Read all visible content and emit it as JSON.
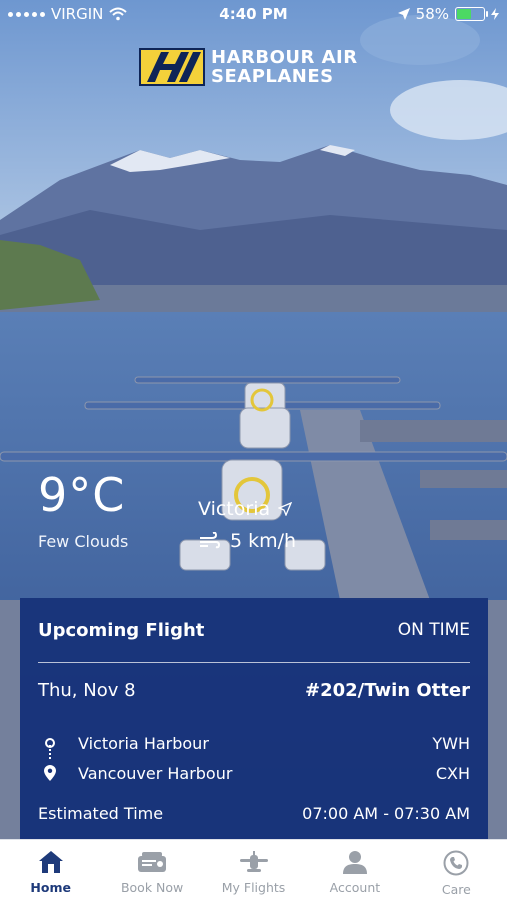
{
  "status_bar": {
    "carrier": "VIRGIN",
    "time": "4:40 PM",
    "battery": "58%"
  },
  "brand": {
    "line1": "HARBOUR AIR",
    "line2": "SEAPLANES",
    "accent": "#f4d13a",
    "navy": "#0e2557"
  },
  "weather": {
    "temperature": "9°C",
    "condition": "Few Clouds",
    "location": "Victoria",
    "wind": "5 km/h"
  },
  "upcoming_flight": {
    "title": "Upcoming Flight",
    "status": "ON TIME",
    "date": "Thu, Nov 8",
    "flight": "#202/Twin Otter",
    "origin_name": "Victoria Harbour",
    "origin_code": "YWH",
    "destination_name": "Vancouver Harbour",
    "destination_code": "CXH",
    "time_label": "Estimated Time",
    "time_value": "07:00 AM - 07:30 AM",
    "card_color": "#173178"
  },
  "tabs": [
    {
      "label": "Home",
      "icon": "home-icon",
      "active": true
    },
    {
      "label": "Book Now",
      "icon": "ticket-icon",
      "active": false
    },
    {
      "label": "My Flights",
      "icon": "plane-icon",
      "active": false
    },
    {
      "label": "Account",
      "icon": "user-icon",
      "active": false
    },
    {
      "label": "Care",
      "icon": "phone-icon",
      "active": false
    }
  ]
}
